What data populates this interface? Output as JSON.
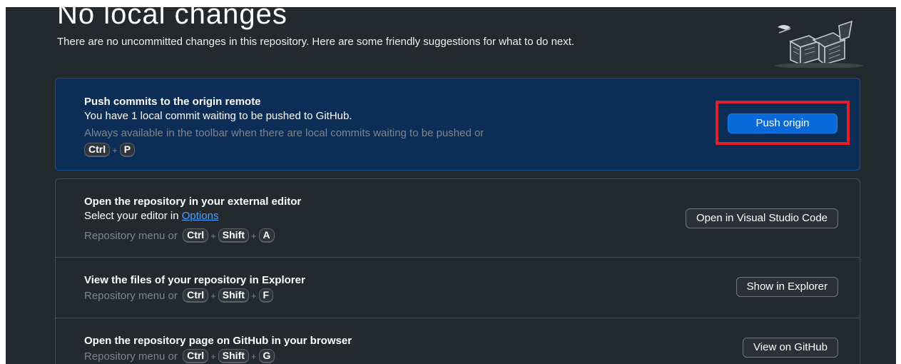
{
  "header": {
    "title": "No local changes",
    "subtitle": "There are no uncommitted changes in this repository. Here are some friendly suggestions for what to do next."
  },
  "push_card": {
    "title": "Push commits to the origin remote",
    "description": "You have 1 local commit waiting to be pushed to GitHub.",
    "hint": "Always available in the toolbar when there are local commits waiting to be pushed or",
    "shortcut_keys": [
      "Ctrl",
      "P"
    ],
    "button_label": "Push origin"
  },
  "editor_card": {
    "title": "Open the repository in your external editor",
    "description_prefix": "Select your editor in",
    "options_link": "Options",
    "hint_prefix": "Repository menu or",
    "shortcut_keys": [
      "Ctrl",
      "Shift",
      "A"
    ],
    "button_label": "Open in Visual Studio Code"
  },
  "explorer_card": {
    "title": "View the files of your repository in Explorer",
    "hint_prefix": "Repository menu or",
    "shortcut_keys": [
      "Ctrl",
      "Shift",
      "F"
    ],
    "button_label": "Show in Explorer"
  },
  "github_card": {
    "title": "Open the repository page on GitHub in your browser",
    "hint_prefix": "Repository menu or",
    "shortcut_keys": [
      "Ctrl",
      "Shift",
      "G"
    ],
    "button_label": "View on GitHub"
  },
  "plus_sign": "+",
  "colors": {
    "background": "#24292e",
    "push_card_bg": "#0c2d55",
    "primary_button": "#0969da",
    "highlight": "#e2202a",
    "link": "#4aa3ff"
  },
  "icons": {
    "illustration": "empty-boxes-illustration"
  }
}
